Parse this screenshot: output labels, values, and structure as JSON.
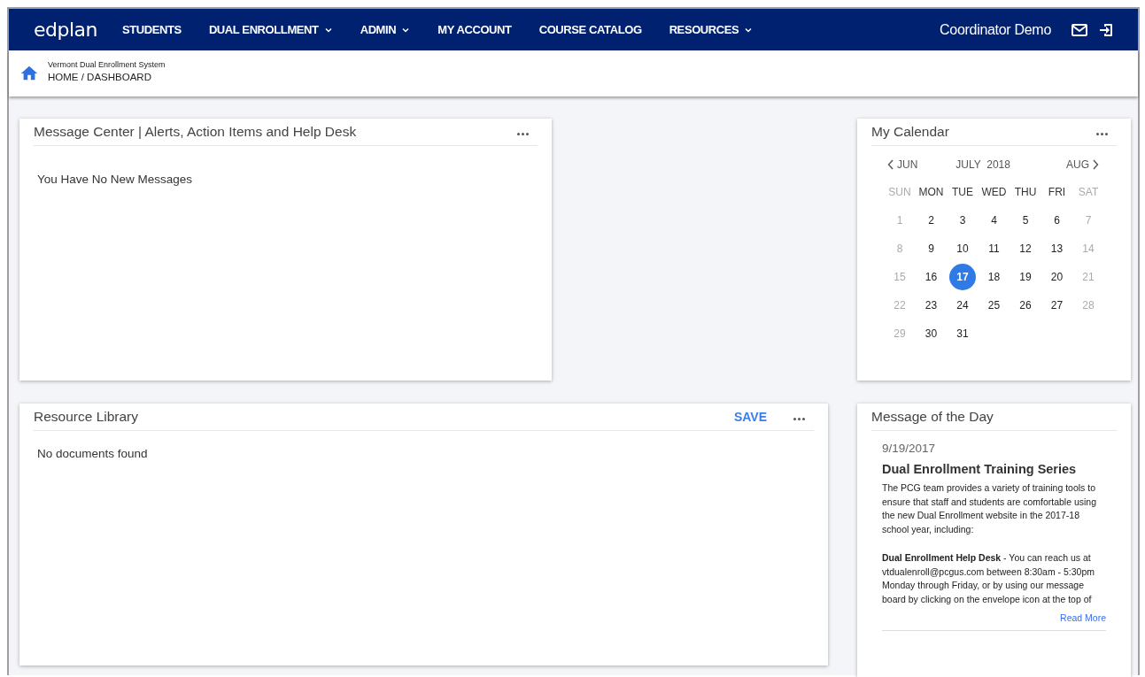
{
  "nav": {
    "logo": "edplan",
    "items": [
      {
        "label": "STUDENTS",
        "dropdown": false
      },
      {
        "label": "DUAL ENROLLMENT",
        "dropdown": true
      },
      {
        "label": "ADMIN",
        "dropdown": true
      },
      {
        "label": "MY ACCOUNT",
        "dropdown": false
      },
      {
        "label": "COURSE CATALOG",
        "dropdown": false
      },
      {
        "label": "RESOURCES",
        "dropdown": true
      }
    ],
    "user": "Coordinator Demo"
  },
  "breadcrumb": {
    "system": "Vermont Dual Enrollment System",
    "path": "HOME / DASHBOARD"
  },
  "message_center": {
    "title": "Message Center | Alerts, Action Items and Help Desk",
    "body": "You Have No New Messages"
  },
  "calendar": {
    "title": "My Calendar",
    "prev": "JUN",
    "month": "JULY  2018",
    "next": "AUG",
    "weekdays": [
      {
        "label": "SUN",
        "weekend": true
      },
      {
        "label": "MON",
        "weekend": false
      },
      {
        "label": "TUE",
        "weekend": false
      },
      {
        "label": "WED",
        "weekend": false
      },
      {
        "label": "THU",
        "weekend": false
      },
      {
        "label": "FRI",
        "weekend": false
      },
      {
        "label": "SAT",
        "weekend": true
      }
    ],
    "days": [
      {
        "day": "1",
        "weekend": true,
        "selected": false
      },
      {
        "day": "2",
        "weekend": false,
        "selected": false
      },
      {
        "day": "3",
        "weekend": false,
        "selected": false
      },
      {
        "day": "4",
        "weekend": false,
        "selected": false
      },
      {
        "day": "5",
        "weekend": false,
        "selected": false
      },
      {
        "day": "6",
        "weekend": false,
        "selected": false
      },
      {
        "day": "7",
        "weekend": true,
        "selected": false
      },
      {
        "day": "8",
        "weekend": true,
        "selected": false
      },
      {
        "day": "9",
        "weekend": false,
        "selected": false
      },
      {
        "day": "10",
        "weekend": false,
        "selected": false
      },
      {
        "day": "11",
        "weekend": false,
        "selected": false
      },
      {
        "day": "12",
        "weekend": false,
        "selected": false
      },
      {
        "day": "13",
        "weekend": false,
        "selected": false
      },
      {
        "day": "14",
        "weekend": true,
        "selected": false
      },
      {
        "day": "15",
        "weekend": true,
        "selected": false
      },
      {
        "day": "16",
        "weekend": false,
        "selected": false
      },
      {
        "day": "17",
        "weekend": false,
        "selected": true
      },
      {
        "day": "18",
        "weekend": false,
        "selected": false
      },
      {
        "day": "19",
        "weekend": false,
        "selected": false
      },
      {
        "day": "20",
        "weekend": false,
        "selected": false
      },
      {
        "day": "21",
        "weekend": true,
        "selected": false
      },
      {
        "day": "22",
        "weekend": true,
        "selected": false
      },
      {
        "day": "23",
        "weekend": false,
        "selected": false
      },
      {
        "day": "24",
        "weekend": false,
        "selected": false
      },
      {
        "day": "25",
        "weekend": false,
        "selected": false
      },
      {
        "day": "26",
        "weekend": false,
        "selected": false
      },
      {
        "day": "27",
        "weekend": false,
        "selected": false
      },
      {
        "day": "28",
        "weekend": true,
        "selected": false
      },
      {
        "day": "29",
        "weekend": true,
        "selected": false
      },
      {
        "day": "30",
        "weekend": false,
        "selected": false
      },
      {
        "day": "31",
        "weekend": false,
        "selected": false
      }
    ]
  },
  "resource_library": {
    "title": "Resource Library",
    "action": "SAVE",
    "body": "No documents found"
  },
  "message_of_the_day": {
    "title": "Message of the Day",
    "date": "9/19/2017",
    "headline": "Dual Enrollment Training Series",
    "paragraphs": [
      "The PCG team provides a variety of training tools to ensure that staff and students are comfortable using the new Dual Enrollment website in the 2017-18 school year, including:",
      "**Dual Enrollment Help Desk** - You can reach us at vtdualenroll@pcgus.com between 8:30am - 5:30pm Monday through Friday, or by using our message board by clicking on the envelope icon at the top of"
    ],
    "link": "Read More"
  }
}
